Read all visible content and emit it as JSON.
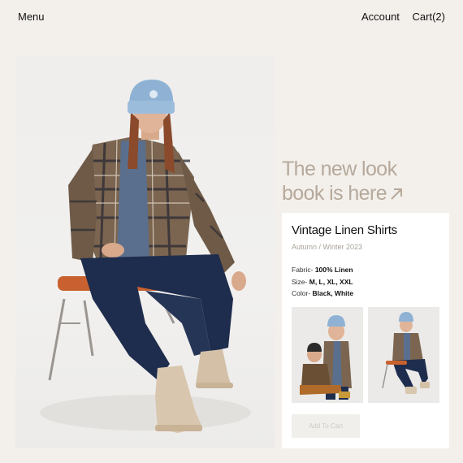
{
  "nav": {
    "menu": "Menu",
    "account": "Account",
    "cart": "Cart(2)"
  },
  "hero": {
    "image": "model-in-plaid-shirt-photo"
  },
  "headline": {
    "line1": "The new look",
    "line2": "book is here"
  },
  "product": {
    "title": "Vintage Linen Shirts",
    "season": "Autumn / Winter 2023",
    "specs": [
      {
        "label": "Fabric",
        "sep": "- ",
        "value": "100% Linen"
      },
      {
        "label": "Size",
        "sep": "- ",
        "value": "M, L, XL, XXL"
      },
      {
        "label": "Color",
        "sep": "- ",
        "value": "Black, White"
      }
    ],
    "thumbnails": [
      "couple-photo",
      "seated-model-photo"
    ],
    "add_to_cart": "Add To Cart"
  },
  "colors": {
    "background": "#f3f0ec",
    "headline": "#b6a99b",
    "card": "#ffffff"
  }
}
